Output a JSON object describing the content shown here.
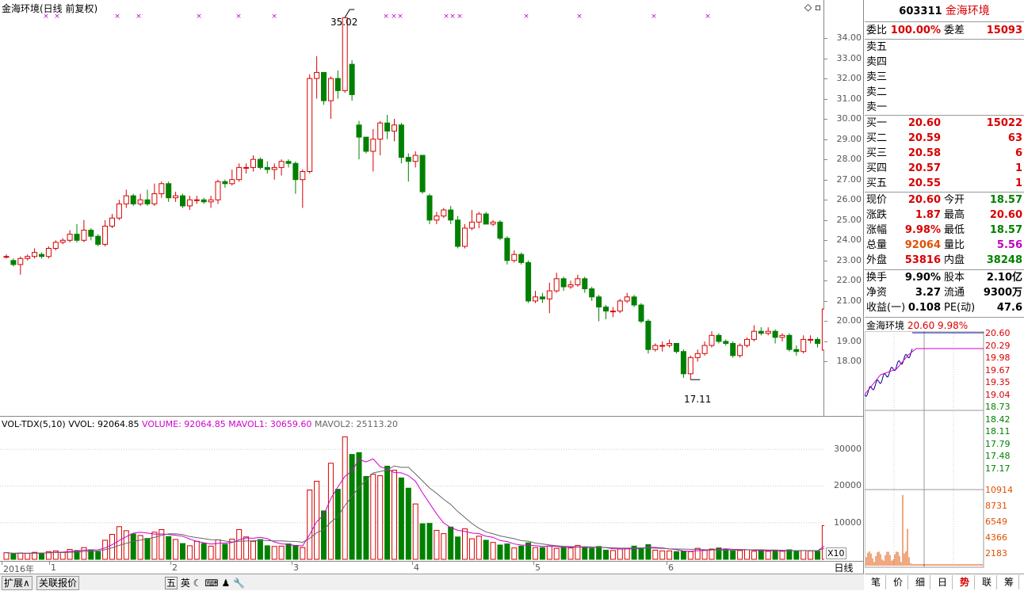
{
  "chart_title": "金海环境(日线 前复权)",
  "high_label": "35.02",
  "low_label": "17.11",
  "price_axis": [
    "34.00",
    "33.00",
    "32.00",
    "31.00",
    "30.00",
    "29.00",
    "28.00",
    "27.00",
    "26.00",
    "25.00",
    "24.00",
    "23.00",
    "22.00",
    "21.00",
    "20.00",
    "19.00",
    "18.00"
  ],
  "volume_legend": {
    "indicator": "VOL-TDX(5,10)",
    "vvol": "VVOL: 92064.85",
    "volume": "VOLUME: 92064.85",
    "mavol1": "MAVOL1: 30659.60",
    "mavol2": "MAVOL2: 25113.20"
  },
  "volume_axis": [
    "30000",
    "20000",
    "10000"
  ],
  "volume_unit": "X10",
  "x_labels": [
    "2016年",
    "1",
    "2",
    "3",
    "4",
    "5",
    "6"
  ],
  "period": "日线",
  "bottom_tabs": [
    "扩展∧",
    "关联报价"
  ],
  "toolbar_icons": [
    "五",
    "英",
    "☾",
    "⌨",
    "♟",
    "🔧"
  ],
  "stock": {
    "code": "603311",
    "name": "金海环境"
  },
  "quote": {
    "weibi_label": "委比",
    "weibi": "100.00%",
    "weicha_label": "委差",
    "weicha": "15093",
    "sell": [
      {
        "label": "卖五"
      },
      {
        "label": "卖四"
      },
      {
        "label": "卖三"
      },
      {
        "label": "卖二"
      },
      {
        "label": "卖一"
      }
    ],
    "buy": [
      {
        "label": "买一",
        "price": "20.60",
        "vol": "15022"
      },
      {
        "label": "买二",
        "price": "20.59",
        "vol": "63"
      },
      {
        "label": "买三",
        "price": "20.58",
        "vol": "6"
      },
      {
        "label": "买四",
        "price": "20.57",
        "vol": "1"
      },
      {
        "label": "买五",
        "price": "20.55",
        "vol": "1"
      }
    ],
    "stats": [
      {
        "l1": "现价",
        "v1": "20.60",
        "l2": "今开",
        "v2": "18.57",
        "c1": "red",
        "c2": "green"
      },
      {
        "l1": "涨跌",
        "v1": "1.87",
        "l2": "最高",
        "v2": "20.60",
        "c1": "red",
        "c2": "red"
      },
      {
        "l1": "涨幅",
        "v1": "9.98%",
        "l2": "最低",
        "v2": "18.57",
        "c1": "red",
        "c2": "green"
      },
      {
        "l1": "总量",
        "v1": "92064",
        "l2": "量比",
        "v2": "5.56",
        "c1": "orange",
        "c2": "mag"
      },
      {
        "l1": "外盘",
        "v1": "53816",
        "l2": "内盘",
        "v2": "38248",
        "c1": "red",
        "c2": "green"
      }
    ],
    "fund": [
      {
        "l1": "换手",
        "v1": "9.90%",
        "l2": "股本",
        "v2": "2.10亿"
      },
      {
        "l1": "净资",
        "v1": "3.27",
        "l2": "流通",
        "v2": "9300万"
      },
      {
        "l1": "收益(一)",
        "v1": "0.108",
        "l2": "PE(动)",
        "v2": "47.6"
      }
    ]
  },
  "mini": {
    "name": "金海环境",
    "price": "20.60",
    "pct": "9.98%",
    "price_ticks": [
      "20.60",
      "20.29",
      "19.98",
      "19.67",
      "19.35",
      "19.04",
      "18.73",
      "18.42",
      "18.11",
      "17.79",
      "17.48",
      "17.17"
    ],
    "vol_ticks": [
      "10914",
      "8731",
      "6549",
      "4366",
      "2183"
    ],
    "tabs": [
      "笔",
      "价",
      "细",
      "日",
      "势",
      "联",
      "筹"
    ]
  },
  "colors": {
    "up": "#d80000",
    "down": "#008000",
    "ma1": "#d000d0",
    "ma2": "#666666"
  },
  "chart_data": {
    "type": "candlestick",
    "title": "金海环境(日线 前复权)",
    "price_range": [
      17.11,
      35.02
    ],
    "candles": [
      [
        23.2,
        23.2,
        23.3,
        23.1
      ],
      [
        23.0,
        22.8,
        23.1,
        22.7
      ],
      [
        22.8,
        23.1,
        23.2,
        22.3
      ],
      [
        23.1,
        23.2,
        23.3,
        23.0
      ],
      [
        23.2,
        23.4,
        23.6,
        23.1
      ],
      [
        23.3,
        23.2,
        23.4,
        23.1
      ],
      [
        23.2,
        23.6,
        23.7,
        23.1
      ],
      [
        23.6,
        23.9,
        24.0,
        23.5
      ],
      [
        23.9,
        24.0,
        24.1,
        23.8
      ],
      [
        24.0,
        24.3,
        24.5,
        23.9
      ],
      [
        24.3,
        24.0,
        24.8,
        23.9
      ],
      [
        24.0,
        24.5,
        25.0,
        23.9
      ],
      [
        24.5,
        24.2,
        24.6,
        24.0
      ],
      [
        24.2,
        23.8,
        24.3,
        23.7
      ],
      [
        23.8,
        24.7,
        25.0,
        23.7
      ],
      [
        24.7,
        25.1,
        25.3,
        24.6
      ],
      [
        25.1,
        25.8,
        26.0,
        25.0
      ],
      [
        25.8,
        26.2,
        26.5,
        25.6
      ],
      [
        26.2,
        25.8,
        26.3,
        25.7
      ],
      [
        25.8,
        26.0,
        26.3,
        25.7
      ],
      [
        26.0,
        25.8,
        26.5,
        25.7
      ],
      [
        25.8,
        26.3,
        26.8,
        25.7
      ],
      [
        26.3,
        26.8,
        26.9,
        26.1
      ],
      [
        26.8,
        26.1,
        26.9,
        25.9
      ],
      [
        26.1,
        26.2,
        26.4,
        25.9
      ],
      [
        26.2,
        25.7,
        26.3,
        25.6
      ],
      [
        25.7,
        26.0,
        26.2,
        25.5
      ],
      [
        26.0,
        26.0,
        26.2,
        25.8
      ],
      [
        26.0,
        25.9,
        26.1,
        25.8
      ],
      [
        25.9,
        26.0,
        26.2,
        25.6
      ],
      [
        26.0,
        26.9,
        27.0,
        25.8
      ],
      [
        26.9,
        26.8,
        27.0,
        26.6
      ],
      [
        26.8,
        27.0,
        27.5,
        26.7
      ],
      [
        27.0,
        27.6,
        27.8,
        26.9
      ],
      [
        27.6,
        27.6,
        27.8,
        27.3
      ],
      [
        27.6,
        28.0,
        28.2,
        27.4
      ],
      [
        28.0,
        27.6,
        28.1,
        27.5
      ],
      [
        27.6,
        27.5,
        27.9,
        27.3
      ],
      [
        27.5,
        27.6,
        27.8,
        27.0
      ],
      [
        27.6,
        27.9,
        28.0,
        27.2
      ],
      [
        27.9,
        27.8,
        28.0,
        27.6
      ],
      [
        27.8,
        27.0,
        27.9,
        26.3
      ],
      [
        27.0,
        27.4,
        27.5,
        25.6
      ],
      [
        27.4,
        32.0,
        32.2,
        27.3
      ],
      [
        32.0,
        32.3,
        33.1,
        31.0
      ],
      [
        32.3,
        30.9,
        31.5,
        30.7
      ],
      [
        30.9,
        32.0,
        32.1,
        30.0
      ],
      [
        32.0,
        31.4,
        32.4,
        31.0
      ],
      [
        31.4,
        35.0,
        35.02,
        31.3
      ],
      [
        32.7,
        31.2,
        32.9,
        30.9
      ],
      [
        29.7,
        29.1,
        29.9,
        28.0
      ],
      [
        29.1,
        28.4,
        28.9,
        28.3
      ],
      [
        28.4,
        29.0,
        29.5,
        27.4
      ],
      [
        29.0,
        29.8,
        29.9,
        28.2
      ],
      [
        29.8,
        29.4,
        30.2,
        29.0
      ],
      [
        29.4,
        29.7,
        30.0,
        28.9
      ],
      [
        29.7,
        28.1,
        29.8,
        27.8
      ],
      [
        28.1,
        27.9,
        28.3,
        26.9
      ],
      [
        27.9,
        28.2,
        28.4,
        27.6
      ],
      [
        28.2,
        26.4,
        28.2,
        26.3
      ],
      [
        26.2,
        25.0,
        26.3,
        24.8
      ],
      [
        25.0,
        25.2,
        25.4,
        24.8
      ],
      [
        25.2,
        25.5,
        25.6,
        25.1
      ],
      [
        25.5,
        25.0,
        25.7,
        24.8
      ],
      [
        25.0,
        23.7,
        25.2,
        23.6
      ],
      [
        23.7,
        24.6,
        24.8,
        23.6
      ],
      [
        24.6,
        24.9,
        25.5,
        24.5
      ],
      [
        24.9,
        25.3,
        25.4,
        24.6
      ],
      [
        25.3,
        24.8,
        25.4,
        24.8
      ],
      [
        24.8,
        24.9,
        25.0,
        24.7
      ],
      [
        24.9,
        24.1,
        25.0,
        24.0
      ],
      [
        24.1,
        23.0,
        24.2,
        22.8
      ],
      [
        23.0,
        23.3,
        23.5,
        22.9
      ],
      [
        23.3,
        22.9,
        23.4,
        22.8
      ],
      [
        22.9,
        21.0,
        23.0,
        20.9
      ],
      [
        21.0,
        21.2,
        21.5,
        20.9
      ],
      [
        21.2,
        21.1,
        21.4,
        20.9
      ],
      [
        21.1,
        21.5,
        21.9,
        20.4
      ],
      [
        21.5,
        22.1,
        22.4,
        21.4
      ],
      [
        22.1,
        21.7,
        22.2,
        21.5
      ],
      [
        21.7,
        21.8,
        22.0,
        21.6
      ],
      [
        21.8,
        22.1,
        22.3,
        21.7
      ],
      [
        22.1,
        21.6,
        22.2,
        21.4
      ],
      [
        21.6,
        21.2,
        21.7,
        21.0
      ],
      [
        21.2,
        20.7,
        21.3,
        20.0
      ],
      [
        20.7,
        20.5,
        20.8,
        20.1
      ],
      [
        20.5,
        20.5,
        20.7,
        20.2
      ],
      [
        20.5,
        21.0,
        21.1,
        20.4
      ],
      [
        21.0,
        21.2,
        21.4,
        20.9
      ],
      [
        21.2,
        20.8,
        21.3,
        20.7
      ],
      [
        20.8,
        20.0,
        20.9,
        19.9
      ],
      [
        20.0,
        18.6,
        20.1,
        18.4
      ],
      [
        18.6,
        18.8,
        18.9,
        18.5
      ],
      [
        18.8,
        18.8,
        19.0,
        18.5
      ],
      [
        18.8,
        18.9,
        19.1,
        18.7
      ],
      [
        18.9,
        18.5,
        18.9,
        18.4
      ],
      [
        18.5,
        17.4,
        18.6,
        17.2
      ],
      [
        17.4,
        18.2,
        18.3,
        17.11
      ],
      [
        18.2,
        18.4,
        18.6,
        18.0
      ],
      [
        18.4,
        18.8,
        19.0,
        18.3
      ],
      [
        18.8,
        19.3,
        19.5,
        18.7
      ],
      [
        19.3,
        19.0,
        19.4,
        18.9
      ],
      [
        19.0,
        18.9,
        19.1,
        18.8
      ],
      [
        18.9,
        18.3,
        19.0,
        18.2
      ],
      [
        18.3,
        18.8,
        18.9,
        18.2
      ],
      [
        18.8,
        19.1,
        19.2,
        18.7
      ],
      [
        19.1,
        19.5,
        19.8,
        19.0
      ],
      [
        19.5,
        19.4,
        19.7,
        19.3
      ],
      [
        19.4,
        19.5,
        19.7,
        19.3
      ],
      [
        19.5,
        19.2,
        19.6,
        18.9
      ],
      [
        19.2,
        19.3,
        19.4,
        19.0
      ],
      [
        19.3,
        18.6,
        19.4,
        18.5
      ],
      [
        18.6,
        18.5,
        18.8,
        18.3
      ],
      [
        18.5,
        19.1,
        19.3,
        18.4
      ],
      [
        19.1,
        19.1,
        19.3,
        18.9
      ],
      [
        19.1,
        18.9,
        19.2,
        18.7
      ],
      [
        18.57,
        20.6,
        20.6,
        18.57
      ]
    ],
    "volume": [
      1800,
      1500,
      1700,
      1600,
      1900,
      1700,
      2100,
      2300,
      1900,
      2700,
      2400,
      3200,
      2600,
      2100,
      5200,
      6800,
      8900,
      7800,
      6900,
      6500,
      5700,
      7400,
      8100,
      6200,
      5400,
      4300,
      3700,
      4900,
      4300,
      3600,
      5300,
      4100,
      5500,
      8100,
      6100,
      4900,
      5400,
      3700,
      3500,
      3600,
      4200,
      3800,
      3200,
      18900,
      21300,
      13200,
      26200,
      19100,
      33400,
      28600,
      29100,
      22600,
      23200,
      22800,
      25400,
      24300,
      22200,
      19400,
      15100,
      9700,
      9800,
      7900,
      7000,
      8800,
      6100,
      8300,
      5600,
      6300,
      5200,
      4600,
      3900,
      4200,
      3100,
      3600,
      4500,
      3200,
      3200,
      3600,
      3000,
      3300,
      3100,
      3800,
      3100,
      3000,
      3500,
      2500,
      2400,
      2800,
      3000,
      3600,
      3100,
      4000,
      2500,
      2300,
      2300,
      2100,
      2200,
      2100,
      3000,
      2600,
      2800,
      3100,
      2800,
      2300,
      2400,
      2600,
      2200,
      2400,
      2200,
      2500,
      2200,
      2600,
      2200,
      2400,
      2300,
      2200,
      9206
    ],
    "volume_range": [
      0,
      35000
    ]
  }
}
